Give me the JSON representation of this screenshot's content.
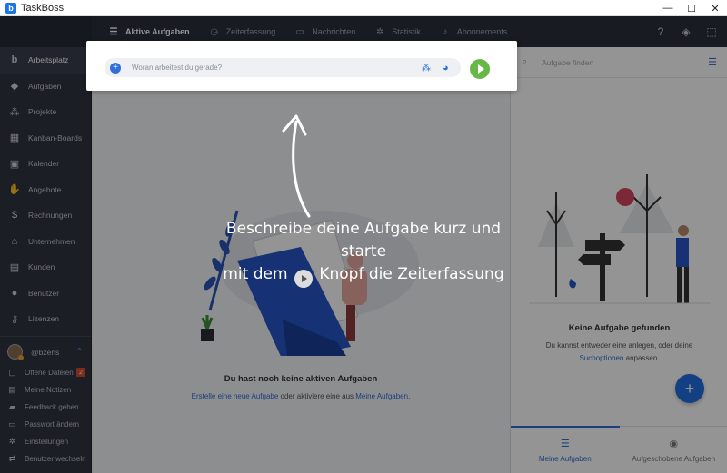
{
  "window": {
    "title": "TaskBoss",
    "controls": [
      "—",
      "☐",
      "✕"
    ]
  },
  "topnav": {
    "tabs": [
      {
        "label": "Aktive Aufgaben",
        "icon": "list-icon"
      },
      {
        "label": "Zeiterfassung",
        "icon": "history-icon"
      },
      {
        "label": "Nachrichten",
        "icon": "chat-icon"
      },
      {
        "label": "Statistik",
        "icon": "gear-icon"
      },
      {
        "label": "Abonnements",
        "icon": "bell-icon"
      }
    ],
    "right_icons": [
      "help-icon",
      "layers-icon",
      "fullscreen-icon"
    ]
  },
  "sidebar": {
    "items": [
      {
        "label": "Arbeitsplatz",
        "icon": "brand-b-icon"
      },
      {
        "label": "Aufgaben",
        "icon": "cube-icon"
      },
      {
        "label": "Projekte",
        "icon": "hierarchy-icon"
      },
      {
        "label": "Kanban-Boards",
        "icon": "kanban-icon"
      },
      {
        "label": "Kalender",
        "icon": "calendar-icon"
      },
      {
        "label": "Angebote",
        "icon": "handshake-icon"
      },
      {
        "label": "Rechnungen",
        "icon": "dollar-icon"
      },
      {
        "label": "Unternehmen",
        "icon": "building-icon"
      },
      {
        "label": "Kunden",
        "icon": "briefcase-icon"
      },
      {
        "label": "Benutzer",
        "icon": "user-icon"
      },
      {
        "label": "Lizenzen",
        "icon": "key-icon"
      }
    ],
    "user": {
      "name": "@bzens"
    },
    "bottom": [
      {
        "label": "Offene Dateien",
        "icon": "file-icon",
        "badge": "2"
      },
      {
        "label": "Meine Notizen",
        "icon": "note-icon"
      },
      {
        "label": "Feedback geben",
        "icon": "feedback-icon"
      },
      {
        "label": "Passwort ändern",
        "icon": "password-icon"
      },
      {
        "label": "Einstellungen",
        "icon": "settings-icon"
      },
      {
        "label": "Benutzer wechseln",
        "icon": "switch-user-icon"
      }
    ]
  },
  "main": {
    "empty_title": "Du hast noch keine aktiven Aufgaben",
    "empty_link1": "Erstelle eine neue Aufgabe",
    "empty_mid": " oder aktiviere eine aus ",
    "empty_link2": "Meine Aufgaben",
    "empty_end": "."
  },
  "right_panel": {
    "search_placeholder": "Aufgabe finden",
    "empty_title": "Keine Aufgabe gefunden",
    "empty_line1": "Du kannst entweder eine anlegen, oder deine",
    "empty_link": "Suchoptionen",
    "empty_line2_end": " anpassen.",
    "fab": "+",
    "tabs": [
      {
        "label": "Meine Aufgaben",
        "icon": "list-plus-icon",
        "active": true
      },
      {
        "label": "Aufgeschobene Aufgaben",
        "icon": "play-circle-icon",
        "active": false
      }
    ]
  },
  "spotlight": {
    "placeholder": "Woran arbeitest du gerade?"
  },
  "hint": {
    "line1": "Beschreibe deine Aufgabe kurz und starte",
    "line2_before": "mit dem ",
    "line2_after": " Knopf die Zeiterfassung"
  }
}
